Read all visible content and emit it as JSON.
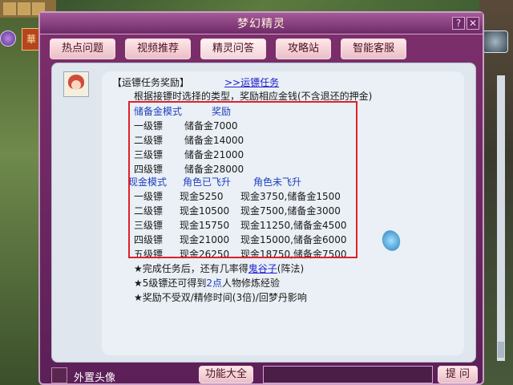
{
  "window": {
    "title": "梦幻精灵"
  },
  "tabs": [
    "热点问题",
    "视频推荐",
    "精灵问答",
    "攻略站",
    "智能客服"
  ],
  "seal_text": "華",
  "content": {
    "heading": "【运镖任务奖励】",
    "heading_link": ">>运镖任务",
    "intro": "根据接镖时选择的类型，奖励相应金钱(不含退还的押金)",
    "reserve_header": [
      "储备金模式",
      "奖励"
    ],
    "reserve_rows": [
      [
        "一级镖",
        "储备金7000"
      ],
      [
        "二级镖",
        "储备金14000"
      ],
      [
        "三级镖",
        "储备金21000"
      ],
      [
        "四级镖",
        "储备金28000"
      ]
    ],
    "cash_header": [
      "现金模式",
      "角色已飞升",
      "角色未飞升"
    ],
    "cash_rows": [
      [
        "一级镖",
        "现金5250",
        "现金3750,储备金1500"
      ],
      [
        "二级镖",
        "现金10500",
        "现金7500,储备金3000"
      ],
      [
        "三级镖",
        "现金15750",
        "现金11250,储备金4500"
      ],
      [
        "四级镖",
        "现金21000",
        "现金15000,储备金6000"
      ],
      [
        "五级镖",
        "现金26250",
        "现金18750,储备金7500"
      ]
    ],
    "note1_pre": "★完成任务后，还有几率得",
    "note1_link": "鬼谷子",
    "note1_post": "(阵法)",
    "note2_pre": "★5级镖还可得到",
    "note2_em": "2点",
    "note2_post": "人物修炼经验",
    "note3": "★奖励不受双/精修时间(3倍)/回梦丹影响"
  },
  "bottom": {
    "checkbox_label": "外置头像",
    "features_button": "功能大全",
    "ask_button": "提 问"
  }
}
